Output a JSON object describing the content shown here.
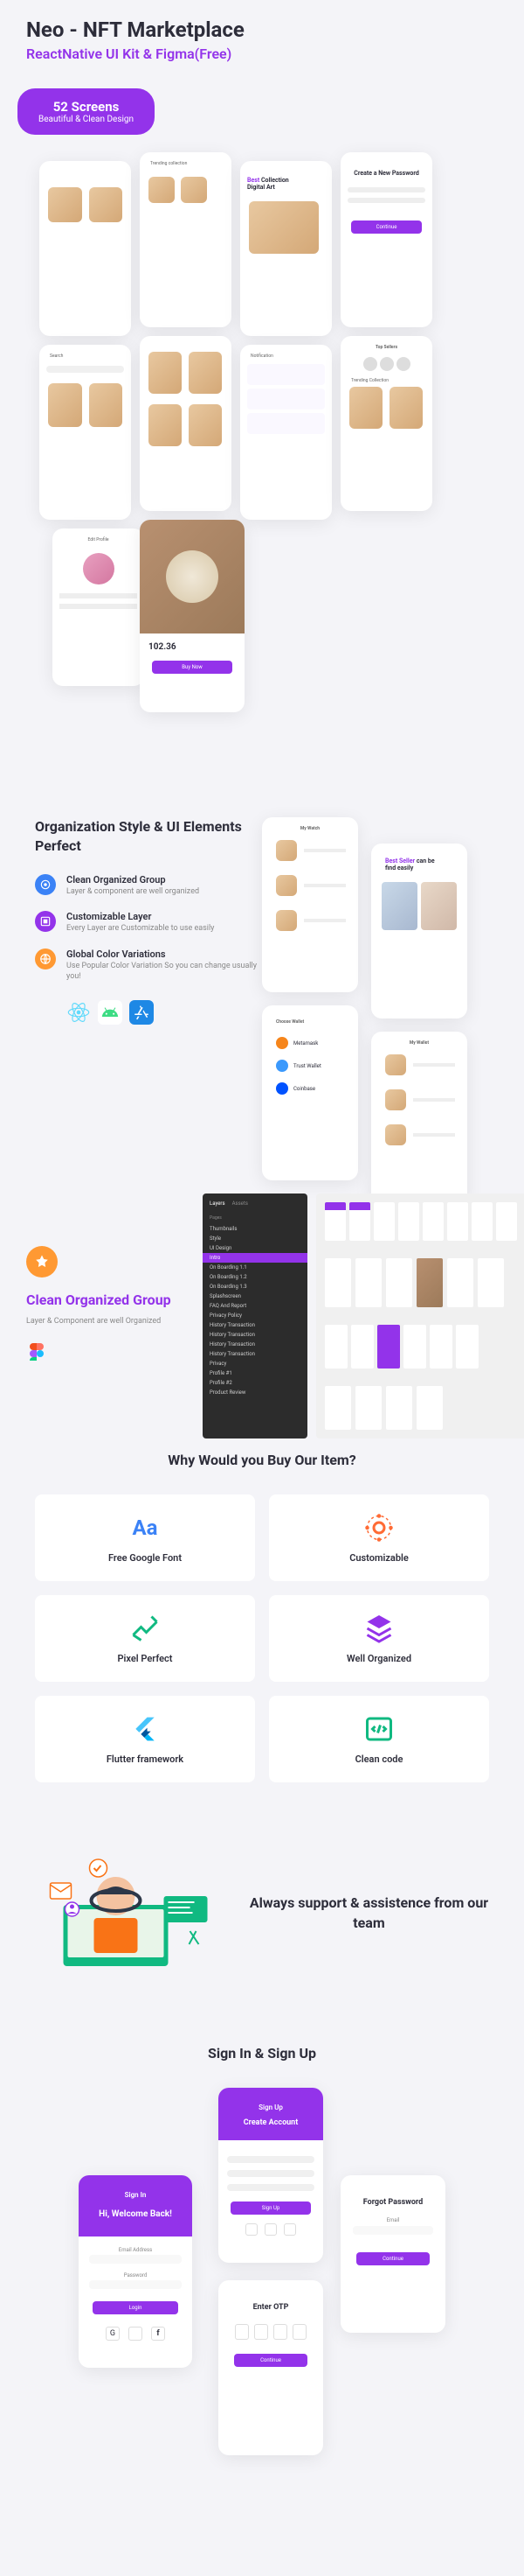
{
  "hero": {
    "title": "Neo - NFT Marketplace",
    "subtitle": "ReactNative UI Kit & Figma(Free)"
  },
  "badge": {
    "title": "52 Screens",
    "subtitle": "Beautiful & Clean Design"
  },
  "screens_preview": {
    "create_password": "Create a New Password",
    "best_collection": "Best Collection Digital Art",
    "trending": "Trending collection",
    "search": "Search",
    "notification": "Notification",
    "top_sellers": "Top Sellers",
    "trending_collection": "Trending Collection",
    "edit_profile": "Edit Profile",
    "price": "102.36"
  },
  "organization": {
    "title": "Organization Style & UI Elements Perfect",
    "items": [
      {
        "title": "Clean Organized Group",
        "desc": "Layer & component are well organized"
      },
      {
        "title": "Customizable Layer",
        "desc": "Every Layer are Customizable to use easily"
      },
      {
        "title": "Global Color Variations",
        "desc": "Use Popular Color Variation So you can change usually you!"
      }
    ],
    "phones": {
      "my_watch": "My Watch",
      "best_seller": "Best Seller can be find easily",
      "choose_wallet": "Choose Wallet",
      "my_wallet": "My Wallet"
    }
  },
  "figma": {
    "title": "Clean Organized Group",
    "desc": "Layer & Component are well Organized",
    "layers_tabs": [
      "Layers",
      "Assets"
    ],
    "pages_label": "Pages",
    "layers": [
      "Thumbnails",
      "Style",
      "UI Design",
      "Intro",
      "On Boarding 1.1",
      "On Boarding 1.2",
      "On Boarding 1.3",
      "Splashscreen",
      "FAQ And Report",
      "Privacy Policy",
      "History Transaction",
      "History Transaction",
      "History Transaction",
      "History Transaction",
      "Privacy",
      "Profile #1",
      "Profile #2",
      "Product Review"
    ]
  },
  "why": {
    "title": "Why Would you Buy Our Item?",
    "cards": [
      {
        "label": "Free Google Font"
      },
      {
        "label": "Customizable"
      },
      {
        "label": "Pixel Perfect"
      },
      {
        "label": "Well Organized"
      },
      {
        "label": "Flutter framework"
      },
      {
        "label": "Clean code"
      }
    ]
  },
  "support": {
    "text": "Always support & assistence from our team"
  },
  "signin": {
    "title": "Sign In & Sign Up",
    "screens": {
      "signup": "Sign Up",
      "create_account": "Create Account",
      "signin": "Sign In",
      "welcome": "Hi, Welcome Back!",
      "forgot": "Forgot Password",
      "enter_otp": "Enter OTP"
    }
  }
}
